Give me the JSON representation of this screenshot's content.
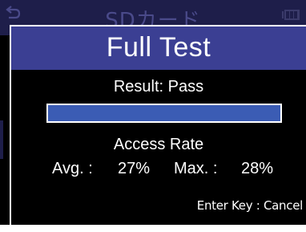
{
  "background": {
    "title": "SDカード",
    "back_icon": "back-arrow-icon",
    "battery_icon": "battery-icon"
  },
  "dialog": {
    "title": "Full Test",
    "result": "Result: Pass",
    "progress": 1.0,
    "access_rate_label": "Access Rate",
    "avg_label": "Avg. :",
    "avg_value": "27%",
    "max_label": "Max. :",
    "max_value": "28%",
    "footer": "Enter Key : Cancel"
  },
  "colors": {
    "title_bar": "#3b3f93",
    "progress_fill": "#3b5cb4",
    "background": "#000000",
    "text": "#ffffff"
  }
}
